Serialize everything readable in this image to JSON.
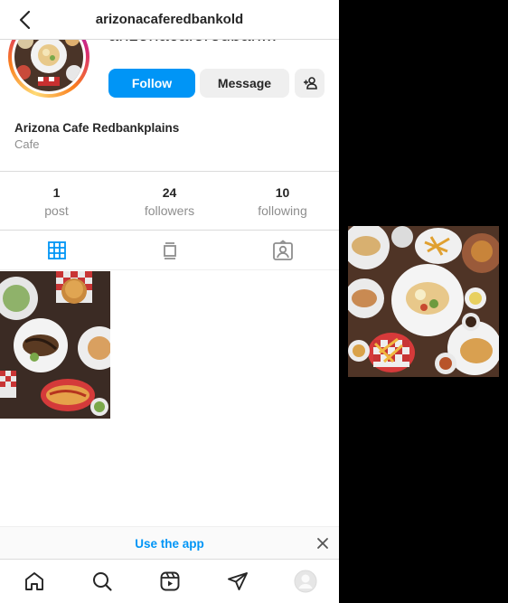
{
  "header": {
    "username": "arizonacaferedbankold",
    "back_icon": "chevron-left-icon"
  },
  "profile": {
    "username_truncated": "arizonacaferedban...",
    "display_name": "Arizona Cafe Redbankplains",
    "category": "Cafe"
  },
  "actions": {
    "follow_label": "Follow",
    "message_label": "Message",
    "suggest_icon": "add-person-icon",
    "follow_color": "#0095f6"
  },
  "stats": [
    {
      "value": "1",
      "label": "post"
    },
    {
      "value": "24",
      "label": "followers"
    },
    {
      "value": "10",
      "label": "following"
    }
  ],
  "tabs": [
    {
      "icon": "grid-icon",
      "active": true
    },
    {
      "icon": "feed-icon",
      "active": false
    },
    {
      "icon": "tagged-icon",
      "active": false
    }
  ],
  "banner": {
    "text": "Use the app",
    "close_icon": "close-icon"
  },
  "bottom_nav": [
    {
      "icon": "home-icon"
    },
    {
      "icon": "search-icon"
    },
    {
      "icon": "reels-icon"
    },
    {
      "icon": "direct-icon"
    },
    {
      "icon": "profile-icon"
    }
  ]
}
